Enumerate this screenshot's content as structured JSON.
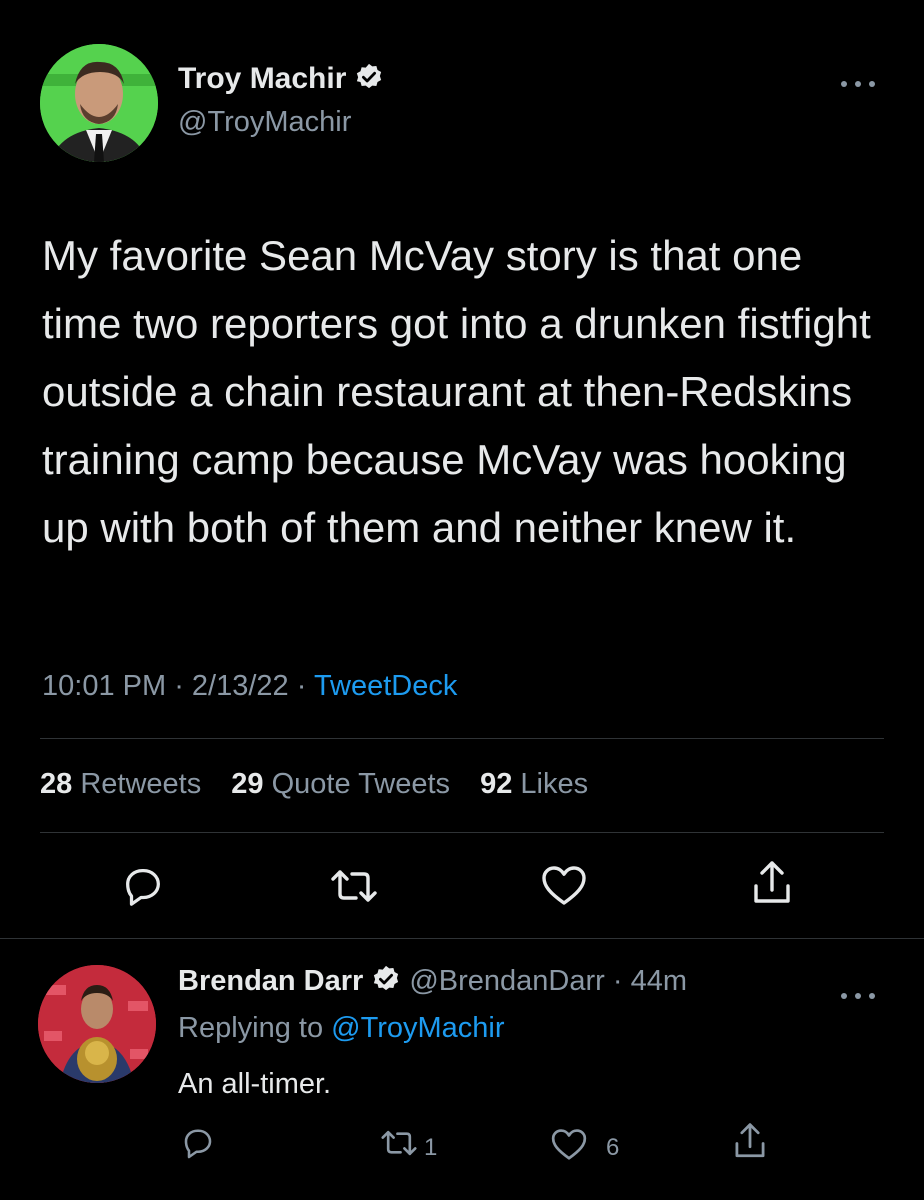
{
  "tweet": {
    "author_name": "Troy Machir",
    "author_handle": "@TroyMachir",
    "more_icon": "more-horizontal-icon",
    "text": "My favorite Sean McVay story is that one time two reporters got into a drunken fistfight outside a chain restaurant at then-Redskins training camp because McVay was hooking up with both of them and neither knew it.",
    "time": "10:01 PM",
    "sep1": " · ",
    "date": "2/13/22",
    "sep2": " · ",
    "source": "TweetDeck",
    "stats": {
      "retweets_count": "28",
      "retweets_label": "Retweets",
      "quotes_count": "29",
      "quotes_label": "Quote Tweets",
      "likes_count": "92",
      "likes_label": "Likes"
    },
    "actions": [
      "reply-icon",
      "retweet-icon",
      "like-icon",
      "share-icon"
    ]
  },
  "reply": {
    "author_name": "Brendan Darr",
    "author_handle": "@BrendanDarr",
    "time": "· 44m",
    "replying_prefix": "Replying to ",
    "replying_to": "@TroyMachir",
    "text": "An all-timer.",
    "retweet_count": "1",
    "like_count": "6"
  },
  "colors": {
    "background": "#000000",
    "text": "#e7e9ea",
    "secondary": "#8b98a5",
    "accent": "#1d9bf0",
    "divider": "#2f3336"
  }
}
